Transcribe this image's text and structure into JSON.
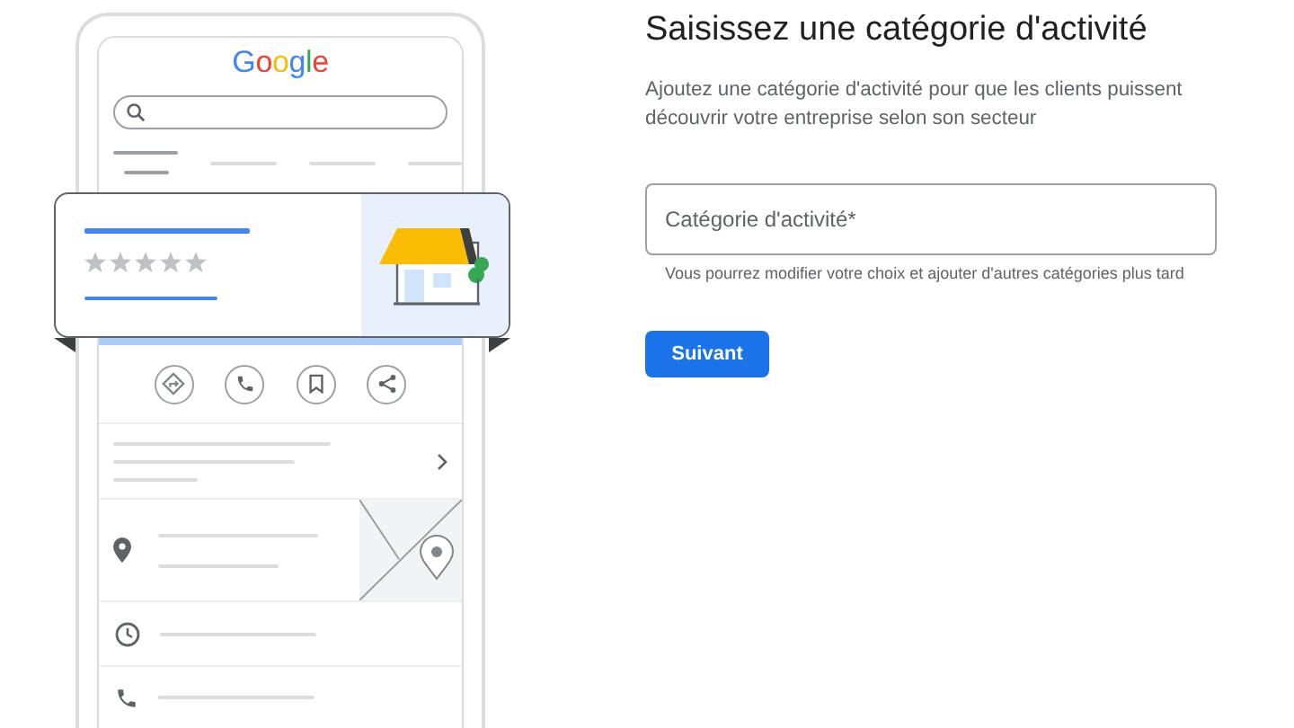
{
  "illustration": {
    "logo": "Google"
  },
  "form": {
    "title": "Saisissez une catégorie d'activité",
    "description": "Ajoutez une catégorie d'activité pour que les clients puissent découvrir votre entreprise selon son secteur",
    "field": {
      "placeholder": "Catégorie d'activité*"
    },
    "helper": "Vous pourrez modifier votre choix et ajouter d'autres catégories plus tard",
    "button": "Suivant"
  }
}
